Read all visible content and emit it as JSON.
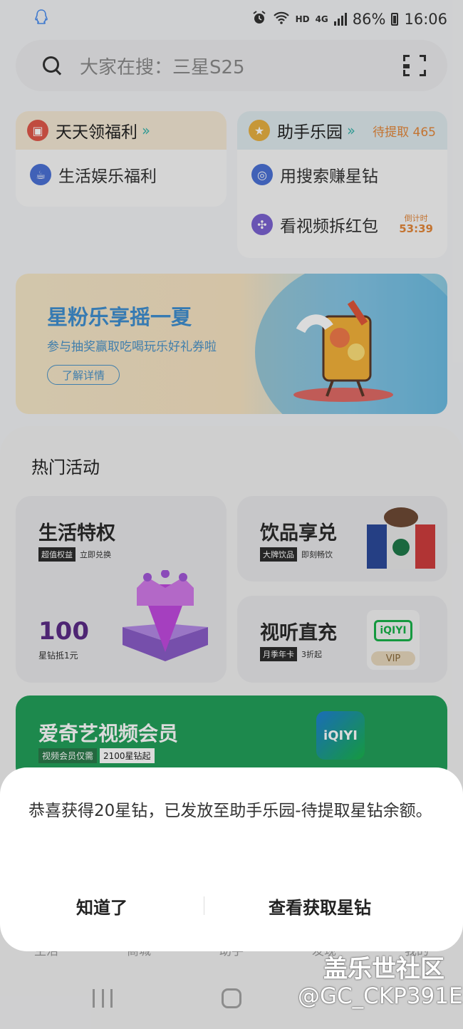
{
  "status_bar": {
    "left_icon": "qq-penguin-icon",
    "alarm_icon": "alarm-icon",
    "wifi_icon": "wifi-icon",
    "hd_label": "HD",
    "network_label": "4G",
    "battery": "86%",
    "time": "16:06"
  },
  "search": {
    "placeholder": "大家在搜：三星S25",
    "icon": "search-icon",
    "scan_icon": "scan-icon"
  },
  "welfare": {
    "daily": {
      "title": "天天领福利",
      "items": [
        {
          "label": "生活娱乐福利",
          "icon": "coffee-icon"
        }
      ]
    },
    "park": {
      "title": "助手乐园",
      "pending": "待提取 465",
      "items": [
        {
          "label": "用搜索赚星钻",
          "icon": "search-coin-icon"
        },
        {
          "label": "看视频拆红包",
          "icon": "video-icon",
          "countdown_label": "倒计时",
          "countdown": "53:39"
        }
      ]
    }
  },
  "banner": {
    "title": "星粉乐享摇一夏",
    "subtitle": "参与抽奖赢取吃喝玩乐好礼券啦",
    "button": "了解详情"
  },
  "hot": {
    "title": "热门活动",
    "tiles": [
      {
        "title": "生活特权",
        "tag": "超值权益",
        "tag_text": "立即兑换",
        "number": "100",
        "number_sub": "星钻抵1元"
      },
      {
        "title": "饮品享兑",
        "tag": "大牌饮品",
        "tag_text": "即刻畅饮"
      },
      {
        "title": "视听直充",
        "tag": "月季年卡",
        "tag_text": "3折起",
        "badge": "VIP"
      }
    ],
    "iqiyi": {
      "title": "爱奇艺视频会员",
      "tag_a": "视频会员仅需",
      "tag_b": "2100星钻起",
      "logo": "iQIYI"
    }
  },
  "dialog": {
    "message": "恭喜获得20星钻，已发放至助手乐园-待提取星钻余额。",
    "ok_button": "知道了",
    "view_button": "查看获取星钻"
  },
  "bottom_nav": [
    "生活",
    "商城",
    "助手",
    "发现",
    "我的"
  ],
  "watermark": {
    "line1": "盖乐世社区",
    "line2": "@GC_CKP391E"
  },
  "colors": {
    "accent_teal": "#3cb4ad",
    "orange": "#e4873a",
    "banner_blue": "#3f8fd0",
    "green_banner": "#22a05a"
  }
}
